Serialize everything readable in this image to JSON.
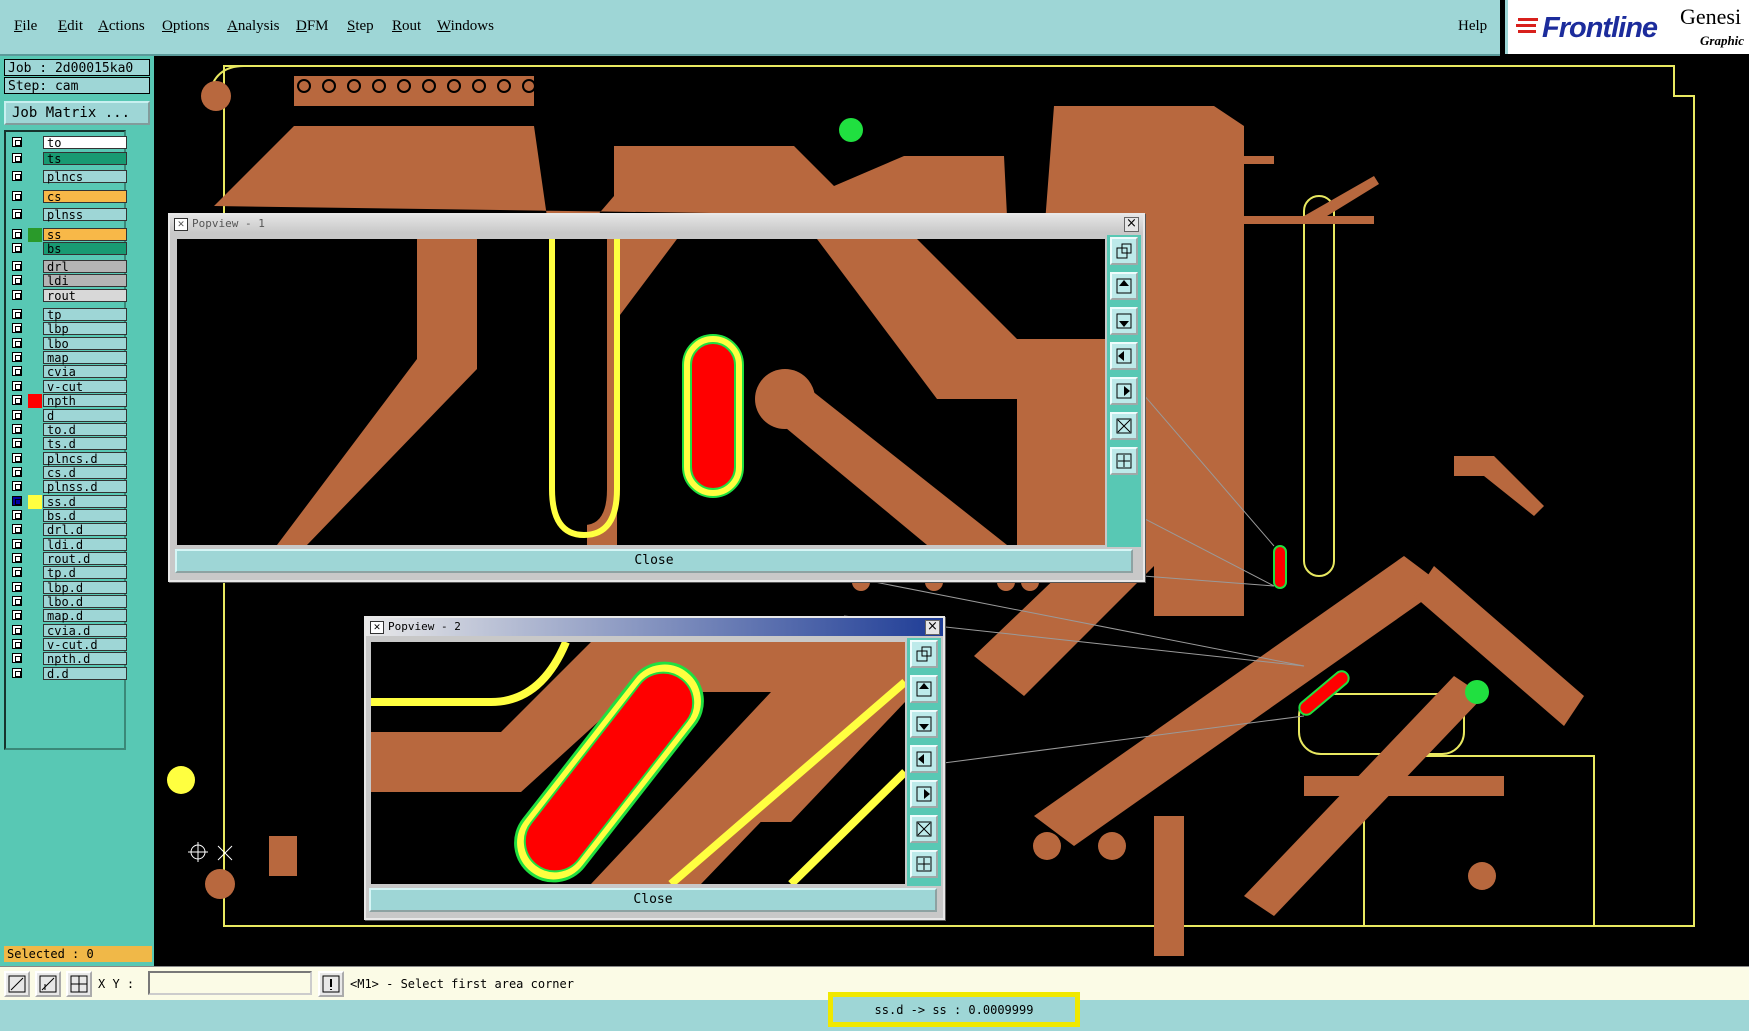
{
  "menu": [
    "File",
    "Edit",
    "Actions",
    "Options",
    "Analysis",
    "DFM",
    "Step",
    "Rout",
    "Windows"
  ],
  "help": "Help",
  "logo": {
    "brand": "Frontline",
    "product": "Genesi",
    "sub": "Graphic",
    "brand_color": "#1c2c9c",
    "mark_color": "#d8201c"
  },
  "job": "Job : 2d00015ka0",
  "step": "Step: cam",
  "job_matrix": "Job Matrix ...",
  "layers": [
    {
      "name": "to",
      "color": "#ffffff",
      "swatch": ""
    },
    {
      "name": "ts",
      "color": "#189a72",
      "swatch": ""
    },
    {
      "name": "plncs",
      "color": "#9ed6d6",
      "swatch": ""
    },
    {
      "name": "cs",
      "color": "#f8b848",
      "swatch": ""
    },
    {
      "name": "plnss",
      "color": "#9ed6d6",
      "swatch": ""
    },
    {
      "name": "ss",
      "color": "#f8b848",
      "swatch": "#2a9a2a"
    },
    {
      "name": "bs",
      "color": "#189a72",
      "swatch": ""
    },
    {
      "name": "drl",
      "color": "#b4b4b4",
      "swatch": ""
    },
    {
      "name": "ldi",
      "color": "#b4b4b4",
      "swatch": ""
    },
    {
      "name": "rout",
      "color": "#d8d8d8",
      "swatch": ""
    },
    {
      "name": "tp",
      "color": "#9ed6d6",
      "swatch": ""
    },
    {
      "name": "lbp",
      "color": "#9ed6d6",
      "swatch": ""
    },
    {
      "name": "lbo",
      "color": "#9ed6d6",
      "swatch": ""
    },
    {
      "name": "map",
      "color": "#9ed6d6",
      "swatch": ""
    },
    {
      "name": "cvia",
      "color": "#9ed6d6",
      "swatch": ""
    },
    {
      "name": "v-cut",
      "color": "#9ed6d6",
      "swatch": ""
    },
    {
      "name": "npth",
      "color": "#9ed6d6",
      "swatch": "#ff0000"
    },
    {
      "name": "d",
      "color": "#9ed6d6",
      "swatch": ""
    },
    {
      "name": "to.d",
      "color": "#9ed6d6",
      "swatch": ""
    },
    {
      "name": "ts.d",
      "color": "#9ed6d6",
      "swatch": ""
    },
    {
      "name": "plncs.d",
      "color": "#9ed6d6",
      "swatch": ""
    },
    {
      "name": "cs.d",
      "color": "#9ed6d6",
      "swatch": ""
    },
    {
      "name": "plnss.d",
      "color": "#9ed6d6",
      "swatch": ""
    },
    {
      "name": "ss.d",
      "color": "#9ed6d6",
      "swatch": "#ffff40",
      "active": true
    },
    {
      "name": "bs.d",
      "color": "#9ed6d6",
      "swatch": ""
    },
    {
      "name": "drl.d",
      "color": "#9ed6d6",
      "swatch": ""
    },
    {
      "name": "ldi.d",
      "color": "#9ed6d6",
      "swatch": ""
    },
    {
      "name": "rout.d",
      "color": "#9ed6d6",
      "swatch": ""
    },
    {
      "name": "tp.d",
      "color": "#9ed6d6",
      "swatch": ""
    },
    {
      "name": "lbp.d",
      "color": "#9ed6d6",
      "swatch": ""
    },
    {
      "name": "lbo.d",
      "color": "#9ed6d6",
      "swatch": ""
    },
    {
      "name": "map.d",
      "color": "#9ed6d6",
      "swatch": ""
    },
    {
      "name": "cvia.d",
      "color": "#9ed6d6",
      "swatch": ""
    },
    {
      "name": "v-cut.d",
      "color": "#9ed6d6",
      "swatch": ""
    },
    {
      "name": "npth.d",
      "color": "#9ed6d6",
      "swatch": ""
    },
    {
      "name": "d.d",
      "color": "#9ed6d6",
      "swatch": ""
    }
  ],
  "selected": "Selected : 0",
  "popview1": {
    "title": "Popview - 1",
    "close": "Close"
  },
  "popview2": {
    "title": "Popview - 2",
    "close": "Close"
  },
  "xy_label": "X Y :",
  "xy_value": "",
  "prompt": "<M1> - Select first area corner",
  "measurement": "ss.d -> ss : 0.0009999",
  "colors": {
    "copper": "#b8683e",
    "outline": "#ffff40",
    "pad": "#20e040",
    "npth": "#ff0000",
    "panel": "#58c8b4",
    "menu": "#9ed6d6"
  }
}
